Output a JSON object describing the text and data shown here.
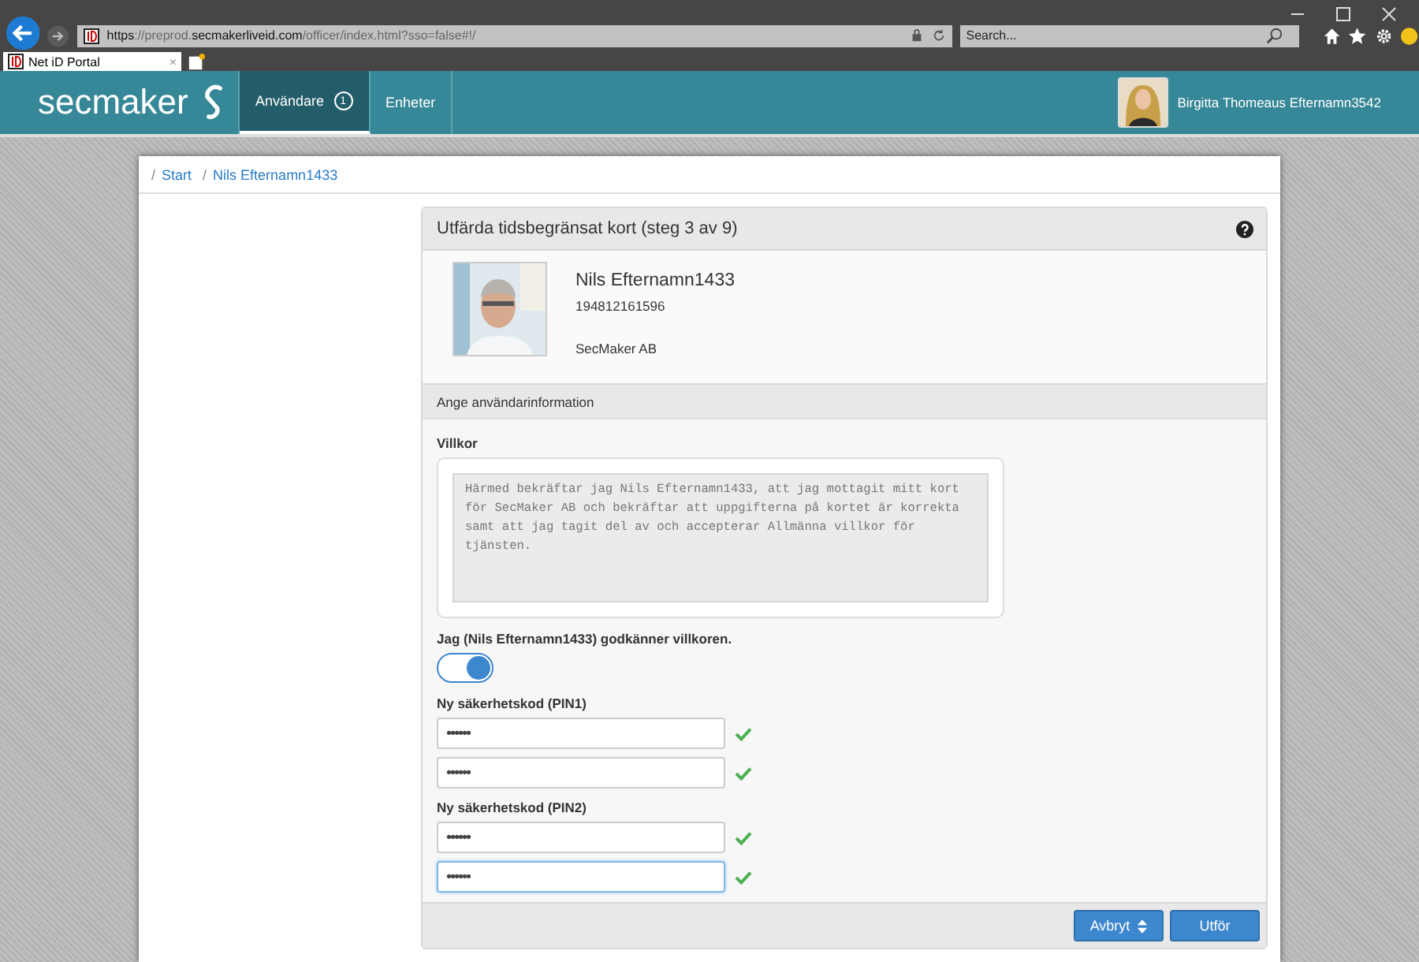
{
  "browser": {
    "url": {
      "scheme": "https",
      "rest": "://preprod.",
      "host": "secmakerliveid.com",
      "path": "/officer/index.html?sso=false#!/"
    },
    "search": {
      "placeholder": "Search..."
    },
    "tab": {
      "title": "Net iD Portal",
      "close": "×"
    }
  },
  "header": {
    "logo": "secmaker",
    "nav": [
      {
        "label": "Användare",
        "badge": "1",
        "selected": true
      },
      {
        "label": "Enheter",
        "selected": false
      }
    ],
    "user": "Birgitta Thomeaus Efternamn3542"
  },
  "breadcrumb": [
    {
      "separator": "/",
      "label": "Start"
    },
    {
      "separator": "/",
      "label": "Nils Efternamn1433"
    }
  ],
  "panel": {
    "title": "Utfärda tidsbegränsat kort (steg 3 av 9)",
    "person": {
      "name": "Nils Efternamn1433",
      "id": "194812161596",
      "org": "SecMaker AB"
    },
    "section": "Ange användarinformation",
    "terms_label": "Villkor",
    "terms": "Härmed bekräftar jag Nils Efternamn1433, att jag mottagit mitt kort för SecMaker AB och bekräftar att uppgifterna på kortet är korrekta samt att jag tagit del av och accepterar Allmänna villkor för tjänsten.",
    "accept_label": "Jag (Nils Efternamn1433) godkänner villkoren.",
    "accept": {
      "on": true
    },
    "groups": [
      {
        "label": "Ny säkerhetskod (PIN1)",
        "fields": [
          {
            "value": "••••••",
            "valid": true,
            "focused": false
          },
          {
            "value": "••••••",
            "valid": true,
            "focused": false
          }
        ]
      },
      {
        "label": "Ny säkerhetskod (PIN2)",
        "fields": [
          {
            "value": "••••••",
            "valid": true,
            "focused": false
          },
          {
            "value": "••••••",
            "valid": true,
            "focused": true
          }
        ]
      }
    ],
    "buttons": [
      {
        "label": "Avbryt",
        "kind": "dropdown"
      },
      {
        "label": "Utför",
        "kind": "plain"
      }
    ]
  }
}
